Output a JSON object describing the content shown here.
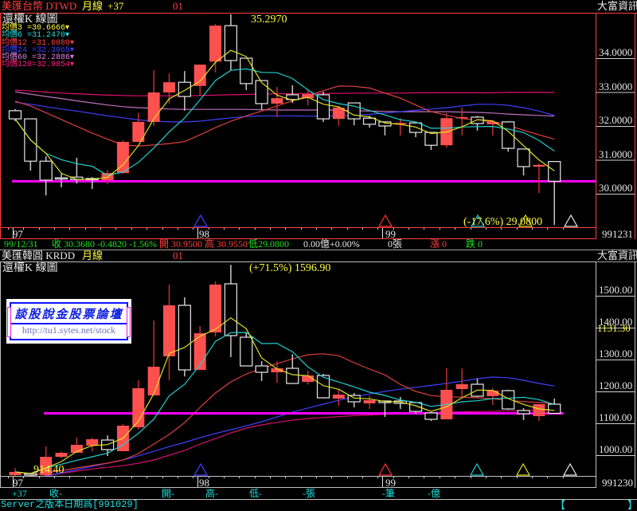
{
  "top_panel": {
    "header": {
      "symbol": "美匯台幣 DTWD",
      "period": "月線",
      "count": "+37",
      "code": "01",
      "brand": "大富資訊"
    },
    "chart_title": "還權K 線圖",
    "ma_legend": [
      {
        "label": "均價3  =30.6666▾",
        "color": "#ffff40"
      },
      {
        "label": "均價6  =31.2470▾",
        "color": "#20e0e0"
      },
      {
        "label": "均價12 =31.6080▾",
        "color": "#ff4040"
      },
      {
        "label": "均價24 =32.3065▾",
        "color": "#4040ff"
      },
      {
        "label": "均價60 =32.2886▾",
        "color": "#e080e0"
      },
      {
        "label": "均價120=32.9854▾",
        "color": "#ff2080"
      }
    ],
    "high_annotation": "35.2970",
    "low_annotation": "(-17.6%) 29.0800",
    "x_labels": [
      "97",
      "98",
      "99"
    ],
    "end_date": "991231",
    "info": {
      "date": "99/12/31",
      "close": "收 30.3680 -0.4820 -1.56%",
      "open_high": "開 30.9500 高 30.9550",
      "low": "低29.0800",
      "amount": "0.00億+0.00%",
      "volume": "0張",
      "up": "漲 0",
      "down": "跌 0"
    }
  },
  "bottom_panel": {
    "header": {
      "symbol": "美匯韓圓 KRDD",
      "period": "月線",
      "code": "01",
      "brand": "大富資訊"
    },
    "chart_title": "還權K 線圖",
    "high_annotation": "(+71.5%) 1596.90",
    "low_annotation": "914.40",
    "last_price": "1131.30",
    "x_labels": [
      "97",
      "98",
      "99"
    ],
    "end_date": "991230",
    "logo": {
      "title": "談股說金股票論壇",
      "url": "http://tu1.sytes.net/stock"
    },
    "info": {
      "count": "+37",
      "close": "收-",
      "open": "開-",
      "high": "高-",
      "low": "低-",
      "volume": "-張",
      "trades": "-筆",
      "amount": "-億"
    }
  },
  "status_bar": {
    "server_date": "Server之版本日期爲[991029]",
    "bracket_left": "【",
    "bracket_right": "】"
  },
  "chart_data": [
    {
      "type": "candlestick",
      "title": "美匯台幣 DTWD 月線",
      "x": "monthly 97/01 - 99/12",
      "ylim": [
        29.0,
        35.4
      ],
      "y_ticks": [
        "34.0000",
        "33.0000",
        "32.0000",
        "31.0000",
        "30.0000"
      ],
      "y_tick_values": [
        34,
        33,
        32,
        31,
        30
      ],
      "reference_line": 30.368,
      "ohlc": [
        [
          32.45,
          32.21,
          32.5,
          32.14
        ],
        [
          32.21,
          30.96,
          32.21,
          30.68
        ],
        [
          30.96,
          30.4,
          31.1,
          29.95
        ],
        [
          30.47,
          30.45,
          30.59,
          30.19
        ],
        [
          30.49,
          30.42,
          31.06,
          30.3
        ],
        [
          30.45,
          30.42,
          30.49,
          30.14
        ],
        [
          30.4,
          30.61,
          30.7,
          30.28
        ],
        [
          30.61,
          31.53,
          31.58,
          30.59
        ],
        [
          31.53,
          32.12,
          32.38,
          31.53
        ],
        [
          32.12,
          32.99,
          33.65,
          32.0
        ],
        [
          32.99,
          33.29,
          33.55,
          32.66
        ],
        [
          33.29,
          32.87,
          33.62,
          32.45
        ],
        [
          33.18,
          33.81,
          33.81,
          32.89
        ],
        [
          33.9,
          34.96,
          35.01,
          33.58
        ],
        [
          34.96,
          33.93,
          35.297,
          33.65
        ],
        [
          34.0,
          33.25,
          34.0,
          33.06
        ],
        [
          33.34,
          32.66,
          33.34,
          32.49
        ],
        [
          32.66,
          32.82,
          33.15,
          32.26
        ],
        [
          32.92,
          32.78,
          33.2,
          32.68
        ],
        [
          32.82,
          32.94,
          33.06,
          32.61
        ],
        [
          32.92,
          32.21,
          33.01,
          32.12
        ],
        [
          32.21,
          32.54,
          32.59,
          32.0
        ],
        [
          32.68,
          32.21,
          32.68,
          32.02
        ],
        [
          32.23,
          32.05,
          32.3,
          31.95
        ],
        [
          32.12,
          32.0,
          32.12,
          31.72
        ],
        [
          32.05,
          32.09,
          32.23,
          31.72
        ],
        [
          32.09,
          31.81,
          32.09,
          31.67
        ],
        [
          31.81,
          31.43,
          31.81,
          31.29
        ],
        [
          31.43,
          32.23,
          32.38,
          31.36
        ],
        [
          32.23,
          32.26,
          32.54,
          31.72
        ],
        [
          32.26,
          32.07,
          32.3,
          31.86
        ],
        [
          32.05,
          32.12,
          32.12,
          31.72
        ],
        [
          32.12,
          31.34,
          32.14,
          31.24
        ],
        [
          31.32,
          30.8,
          31.32,
          30.54
        ],
        [
          30.8,
          30.85,
          30.89,
          30.02
        ],
        [
          30.95,
          30.368,
          30.955,
          29.08
        ]
      ],
      "ma": {
        "ma12": [
          32.73,
          32.59,
          32.39,
          32.19,
          31.99,
          31.79,
          31.61,
          31.44,
          31.41,
          31.44,
          31.48,
          31.54,
          31.74,
          31.95,
          32.14,
          32.3,
          32.44,
          32.59,
          32.74,
          32.89,
          33.04,
          33.18,
          33.17,
          33.12,
          32.97,
          32.82,
          32.62,
          32.42,
          32.32,
          32.22,
          32.17,
          32.12,
          32.02,
          31.87,
          31.74,
          31.61
        ],
        "ma24": [
          32.7,
          32.64,
          32.57,
          32.5,
          32.44,
          32.37,
          32.3,
          32.24,
          32.18,
          32.14,
          32.12,
          32.12,
          32.14,
          32.19,
          32.24,
          32.28,
          32.3,
          32.3,
          32.3,
          32.29,
          32.29,
          32.3,
          32.32,
          32.34,
          32.38,
          32.42,
          32.46,
          32.5,
          32.54,
          32.59,
          32.64,
          32.64,
          32.61,
          32.54,
          32.44,
          32.31
        ],
        "ma60": [
          33.01,
          32.94,
          32.87,
          32.81,
          32.74,
          32.68,
          32.62,
          32.57,
          32.54,
          32.52,
          32.5,
          32.49,
          32.49,
          32.49,
          32.49,
          32.49,
          32.48,
          32.47,
          32.47,
          32.47,
          32.47,
          32.46,
          32.45,
          32.44,
          32.43,
          32.42,
          32.42,
          32.42,
          32.42,
          32.41,
          32.4,
          32.38,
          32.35,
          32.33,
          32.31,
          32.29
        ],
        "ma120": [
          33.06,
          33.03,
          33.0,
          32.97,
          32.95,
          32.93,
          32.91,
          32.9,
          32.89,
          32.89,
          32.89,
          32.89,
          32.9,
          32.91,
          32.92,
          32.93,
          32.94,
          32.95,
          32.95,
          32.96,
          32.96,
          32.96,
          32.97,
          32.97,
          32.97,
          32.97,
          32.98,
          32.98,
          32.98,
          32.98,
          32.98,
          32.98,
          32.99,
          32.99,
          32.99,
          32.99
        ]
      }
    },
    {
      "type": "candlestick",
      "title": "美匯韓圓 KRDD 月線",
      "x": "monthly 97/01 - 99/12",
      "ylim": [
        932,
        1600
      ],
      "y_ticks": [
        "1500.00",
        "1400.00",
        "1300.00",
        "1200.00",
        "1100.00",
        "1000.00"
      ],
      "y_tick_values": [
        1500,
        1400,
        1300,
        1200,
        1100,
        1000
      ],
      "reference_line": 1131.3,
      "ohlc": [
        [
          937.5,
          947.5,
          960,
          914.4
        ],
        [
          942,
          937.5,
          945,
          932
        ],
        [
          937.5,
          995,
          1027.5,
          932
        ],
        [
          995,
          1007.5,
          1012,
          990
        ],
        [
          1007.5,
          1032.5,
          1055,
          1007.5
        ],
        [
          1030,
          1050,
          1055,
          1012
        ],
        [
          1047.5,
          1017.5,
          1062,
          997.5
        ],
        [
          1012.5,
          1092.5,
          1097.5,
          1012.5
        ],
        [
          1087.5,
          1210,
          1235,
          1080
        ],
        [
          1187.5,
          1277.5,
          1422,
          1187.5
        ],
        [
          1310,
          1470,
          1535,
          1235
        ],
        [
          1470,
          1267.5,
          1495,
          1247
        ],
        [
          1267.5,
          1382.5,
          1405,
          1267.5
        ],
        [
          1385,
          1535,
          1545,
          1372
        ],
        [
          1537.5,
          1375,
          1596.9,
          1307.5
        ],
        [
          1370,
          1280,
          1385,
          1280
        ],
        [
          1280,
          1260,
          1295,
          1232.5
        ],
        [
          1260,
          1272.5,
          1295,
          1227
        ],
        [
          1272.5,
          1225,
          1317,
          1225
        ],
        [
          1230,
          1250,
          1265,
          1222
        ],
        [
          1250,
          1180,
          1255,
          1178
        ],
        [
          1177.5,
          1190,
          1205,
          1155
        ],
        [
          1187.5,
          1167.5,
          1195,
          1150
        ],
        [
          1162.5,
          1172.5,
          1187,
          1145
        ],
        [
          1170,
          1165,
          1170,
          1120
        ],
        [
          1170,
          1162.5,
          1182.5,
          1145
        ],
        [
          1165,
          1137.5,
          1165,
          1130
        ],
        [
          1132.5,
          1112.5,
          1135,
          1107.5
        ],
        [
          1112.5,
          1205,
          1272.5,
          1112.5
        ],
        [
          1207.5,
          1222.5,
          1272,
          1180
        ],
        [
          1222.5,
          1185,
          1240,
          1182.5
        ],
        [
          1185,
          1202.5,
          1210,
          1157.5
        ],
        [
          1202.5,
          1145,
          1205,
          1142.5
        ],
        [
          1140,
          1130,
          1147.5,
          1110
        ],
        [
          1122.5,
          1160,
          1160,
          1107.5
        ],
        [
          1160,
          1131.3,
          1177.5,
          1131.3
        ]
      ],
      "ma": {
        "ma12": [
          925,
          935,
          945,
          952,
          960,
          968,
          975,
          985,
          1005,
          1035,
          1065,
          1102,
          1150,
          1195,
          1230,
          1255,
          1272,
          1287,
          1302,
          1315,
          1318,
          1312,
          1290,
          1270,
          1252,
          1222,
          1200,
          1187,
          1183,
          1182,
          1180,
          1177,
          1172,
          1168,
          1165,
          1162
        ],
        "ma24": [
          915,
          925,
          935,
          945,
          955,
          965,
          975,
          985,
          998,
          1012,
          1027,
          1040,
          1055,
          1068,
          1080,
          1092,
          1105,
          1120,
          1135,
          1148,
          1160,
          1172,
          1183,
          1192,
          1200,
          1207,
          1213,
          1219,
          1225,
          1232,
          1240,
          1245,
          1243,
          1235,
          1225,
          1217
        ],
        "ma60": [
          915,
          925,
          935,
          943,
          950,
          957,
          962,
          967,
          975,
          985,
          1000,
          1015,
          1035,
          1052,
          1070,
          1085,
          1095,
          1103,
          1110,
          1115,
          1118,
          1121,
          1124,
          1126,
          1128,
          1130,
          1131,
          1133,
          1135,
          1136,
          1137,
          1138,
          1139,
          1140,
          1141,
          1142
        ]
      }
    }
  ],
  "colors": {
    "up": "#ff5050",
    "down": "#e8e8e8",
    "ma3": "#e0e020",
    "ma6": "#20d0d0",
    "ma12": "#e04040",
    "ma24": "#4040ff",
    "ma60_top": "#c070c0",
    "ma120": "#e01070",
    "ma60_bottom": "#d01070",
    "ref_line": "#ff00ff",
    "frame": "#ff4040"
  }
}
